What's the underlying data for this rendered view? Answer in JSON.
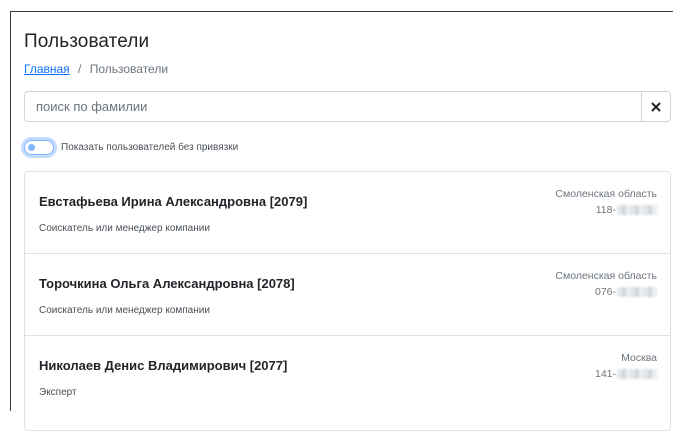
{
  "page": {
    "title": "Пользователи"
  },
  "breadcrumb": {
    "home": "Главная",
    "separator": "/",
    "current": "Пользователи"
  },
  "search": {
    "value": "",
    "placeholder": "поиск по фамилии",
    "clear_icon": "close-icon"
  },
  "toggle": {
    "label": "Показать пользователей без привязки",
    "checked": false
  },
  "users": [
    {
      "name": "Евстафьева Ирина Александровна [2079]",
      "role": "Соискатель или менеджер компании",
      "region": "Смоленская область",
      "phone_prefix": "118-"
    },
    {
      "name": "Торочкина Ольга Александровна [2078]",
      "role": "Соискатель или менеджер компании",
      "region": "Смоленская область",
      "phone_prefix": "076-"
    },
    {
      "name": "Николаев Денис Владимирович [2077]",
      "role": "Эксперт",
      "region": "Москва",
      "phone_prefix": "141-"
    }
  ],
  "colors": {
    "link": "#0d6efd",
    "switch_border": "#86b7fe",
    "border": "#dee2e6",
    "muted_text": "#6c757d"
  }
}
